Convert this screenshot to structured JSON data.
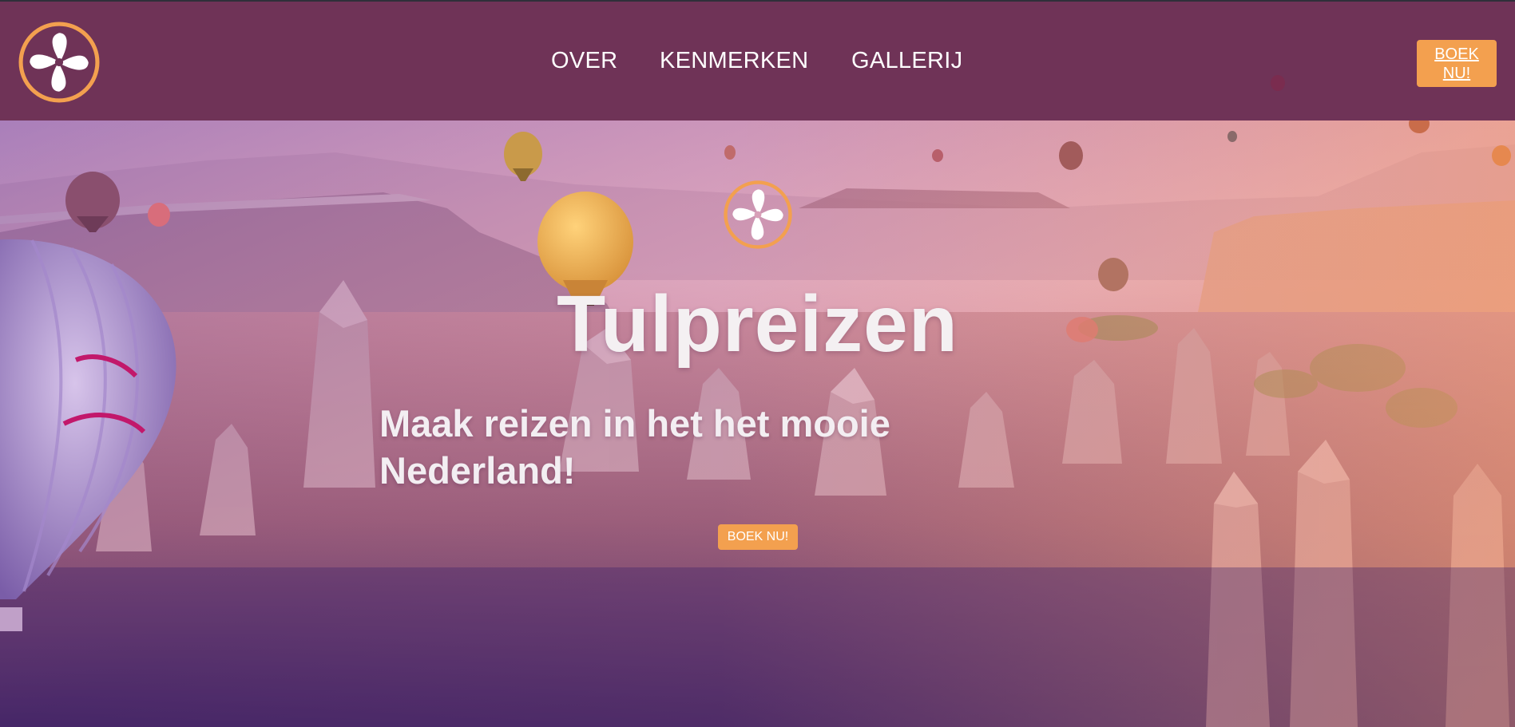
{
  "nav": {
    "over": "OVER",
    "kenmerken": "KENMERKEN",
    "gallerij": "GALLERIJ"
  },
  "header": {
    "book_label": "BOEK NU!",
    "logo_icon": "pinwheel-logo-icon"
  },
  "hero": {
    "title": "Tulpreizen",
    "subtitle": "Maak reizen in het het mooie Nederland!",
    "book_label": "BOEK NU!",
    "background": "hot-air-balloons-over-rock-valley-photo"
  },
  "colors": {
    "header_bg": "#6f3357",
    "accent": "#f3a04f",
    "text": "#ffffff"
  }
}
